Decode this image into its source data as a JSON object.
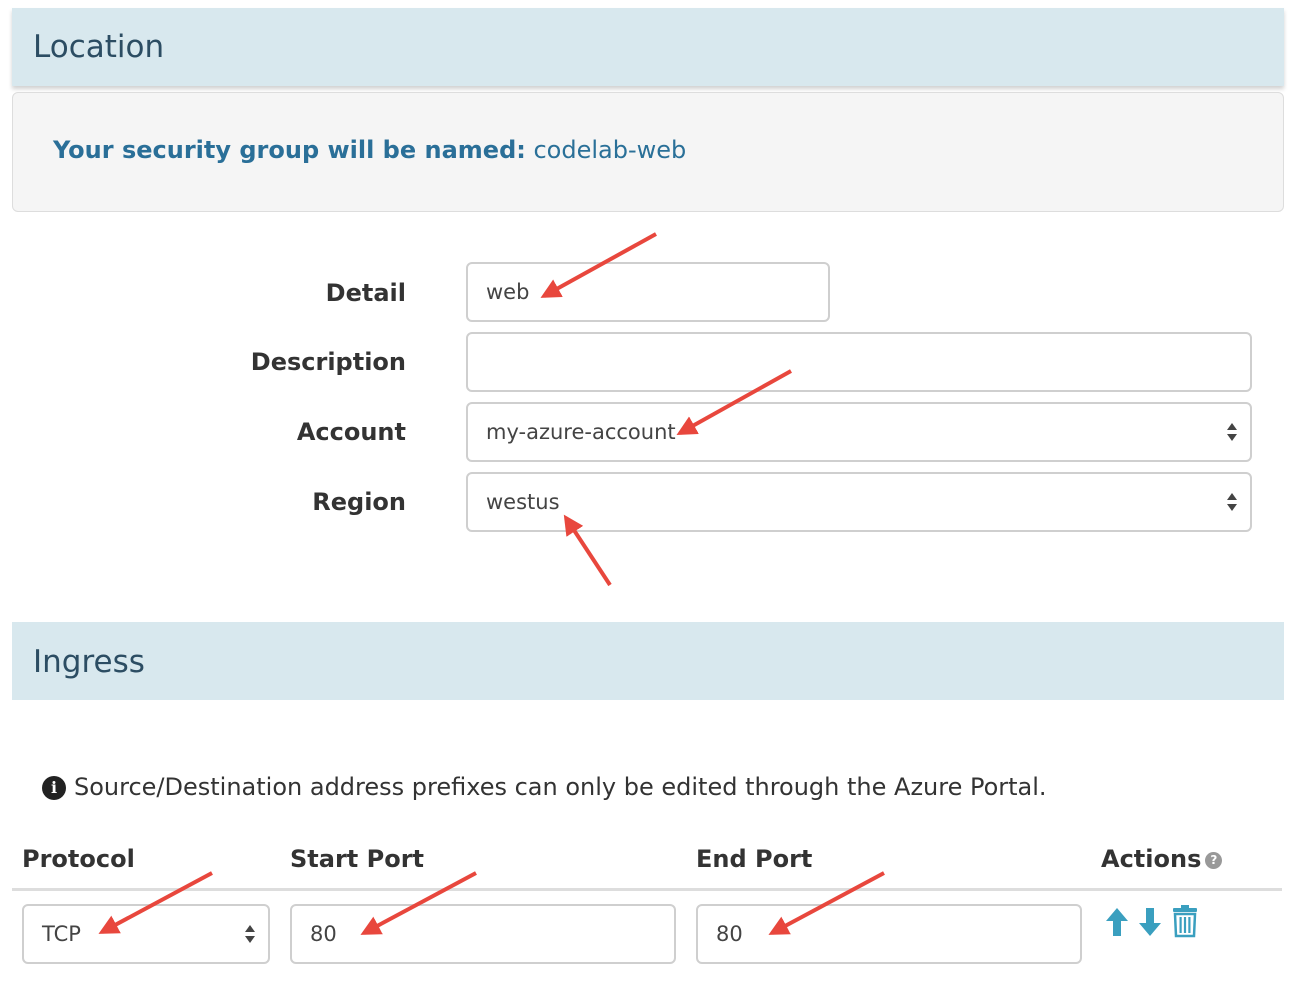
{
  "location": {
    "header": "Location",
    "name_label": "Your security group will be named:",
    "name_value": "codelab-web"
  },
  "form": {
    "detail": {
      "label": "Detail",
      "value": "web"
    },
    "description": {
      "label": "Description",
      "value": ""
    },
    "account": {
      "label": "Account",
      "value": "my-azure-account"
    },
    "region": {
      "label": "Region",
      "value": "westus"
    }
  },
  "ingress": {
    "header": "Ingress",
    "info": "Source/Destination address prefixes can only be edited through the Azure Portal.",
    "columns": {
      "protocol": "Protocol",
      "start_port": "Start Port",
      "end_port": "End Port",
      "actions": "Actions"
    },
    "rows": [
      {
        "protocol": "TCP",
        "start_port": "80",
        "end_port": "80"
      }
    ]
  },
  "icons": {
    "info": "info-circle-icon",
    "help": "question-circle-icon",
    "move_up": "arrow-up-icon",
    "move_down": "arrow-down-icon",
    "delete": "trash-icon",
    "select_caret": "sort-caret-icon",
    "annotation": "red-arrow-icon"
  },
  "colors": {
    "header_bg": "#d8e8ee",
    "header_text": "#2c4d63",
    "link_blue": "#2a7098",
    "action_teal": "#3a9fbf",
    "annotation_red": "#e8473d"
  }
}
